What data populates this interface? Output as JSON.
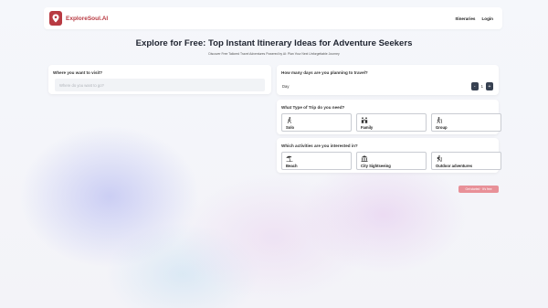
{
  "header": {
    "brand": "ExploreSoul.AI",
    "nav": [
      "Itineraries",
      "Login"
    ]
  },
  "hero": {
    "title": "Explore for Free: Top Instant Itinerary Ideas for Adventure Seekers",
    "subtitle": "Discover Free Tailored Travel Adventures Powered by AI: Plan Your Next Unforgettable Journey"
  },
  "destination": {
    "question": "Where you want to visit?",
    "placeholder": "Where do you want to go?"
  },
  "days": {
    "question": "How many days are you planning to travel?",
    "unit_label": "Day",
    "minus": "-",
    "value": "1",
    "plus": "+"
  },
  "trip_type": {
    "question": "What Type of Trip do you need?",
    "options": [
      {
        "label": "Solo",
        "icon": "person-walking-icon"
      },
      {
        "label": "Family",
        "icon": "family-icon"
      },
      {
        "label": "Group",
        "icon": "group-icon"
      }
    ]
  },
  "activities": {
    "question": "Which activities are you interested in?",
    "options": [
      {
        "label": "Beach",
        "icon": "beach-umbrella-icon"
      },
      {
        "label": "City Sightseeing",
        "icon": "landmark-icon"
      },
      {
        "label": "Outdoor adventures",
        "icon": "hiker-icon"
      }
    ]
  },
  "submit": {
    "label": "Get started · It's free"
  },
  "colors": {
    "brand": "#b83a42",
    "button": "#e89098",
    "stepper": "#374151"
  }
}
